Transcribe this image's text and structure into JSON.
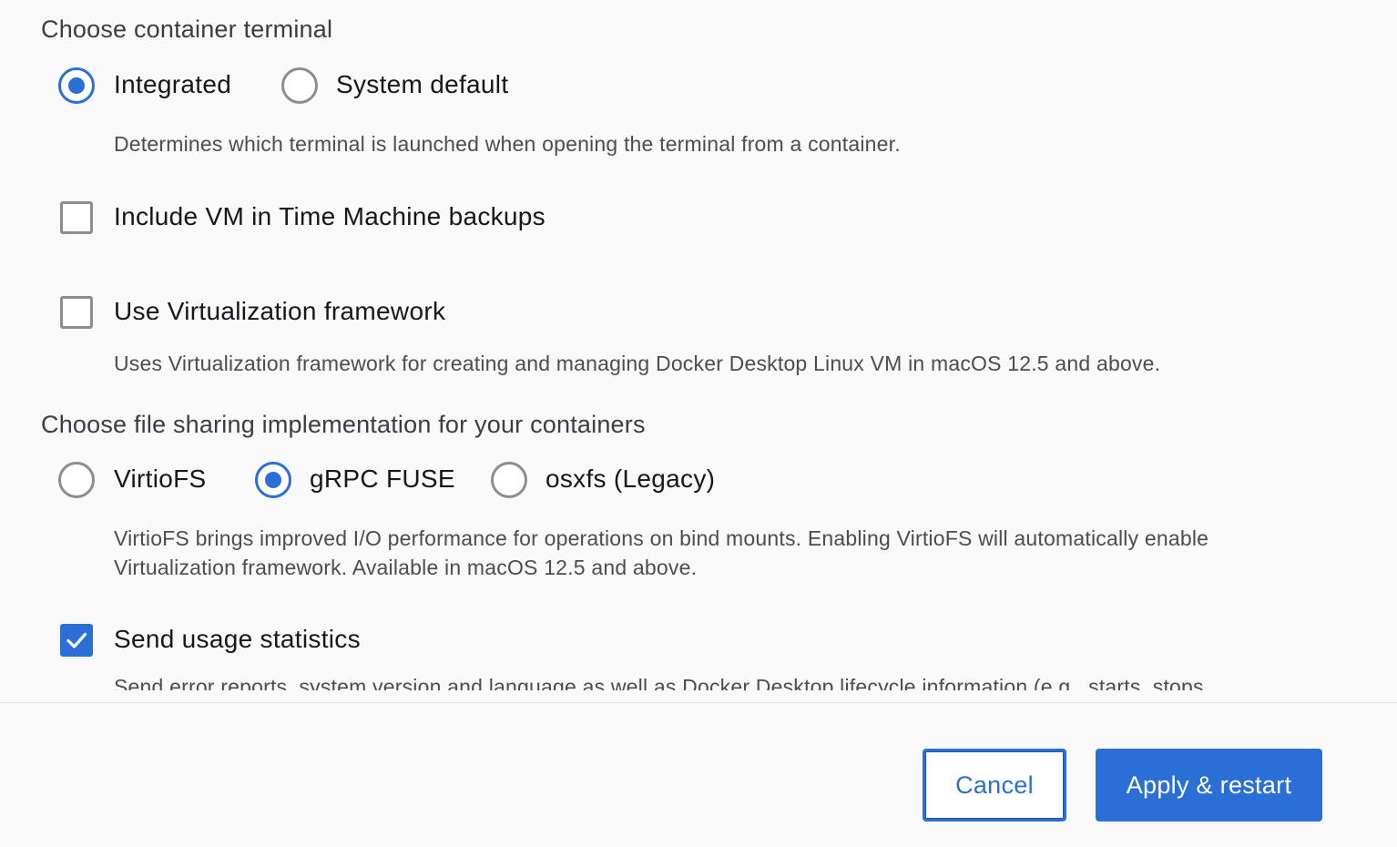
{
  "terminal": {
    "title": "Choose container terminal",
    "options": [
      {
        "label": "Integrated",
        "selected": true
      },
      {
        "label": "System default",
        "selected": false
      }
    ],
    "help": "Determines which terminal is launched when opening the terminal from a container."
  },
  "time_machine": {
    "label": "Include VM in Time Machine backups",
    "checked": false
  },
  "virtualization": {
    "label": "Use Virtualization framework",
    "checked": false,
    "help": "Uses Virtualization framework for creating and managing Docker Desktop Linux VM in macOS 12.5 and above."
  },
  "file_sharing": {
    "title": "Choose file sharing implementation for your containers",
    "options": [
      {
        "label": "VirtioFS",
        "selected": false
      },
      {
        "label": "gRPC FUSE",
        "selected": true
      },
      {
        "label": "osxfs (Legacy)",
        "selected": false
      }
    ],
    "help_line1": "VirtioFS brings improved I/O performance for operations on bind mounts. Enabling VirtioFS will automatically enable",
    "help_line2": "Virtualization framework. Available in macOS 12.5 and above."
  },
  "usage_stats": {
    "label": "Send usage statistics",
    "checked": true,
    "help_partial": "Send error reports, system version and language as well as Docker Desktop lifecycle information (e.g., starts, stops,"
  },
  "footer": {
    "cancel_label": "Cancel",
    "apply_label": "Apply & restart"
  },
  "colors": {
    "accent": "#2a6fd6",
    "background": "#f9f9fa",
    "unchecked_border": "#8a8d93"
  }
}
